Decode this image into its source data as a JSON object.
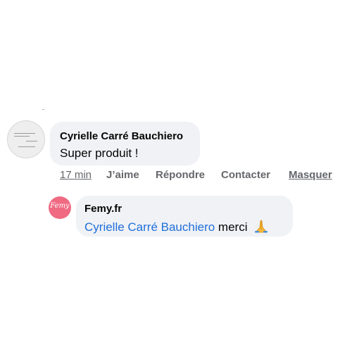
{
  "comment": {
    "author": "Cyrielle Carré Bauchiero",
    "text": "Super produit !",
    "avatar_icon": "quote-image-avatar",
    "actions": {
      "time": "17 min",
      "like": "J’aime",
      "reply": "Répondre",
      "contact": "Contacter",
      "hide": "Masquer"
    }
  },
  "reply": {
    "author": "Femy.fr",
    "avatar_icon": "femy-logo-avatar",
    "logo_text": "Femy",
    "mention": "Cyrielle Carré Bauchiero",
    "text": "merci",
    "emoji_icon": "folded-hands-icon"
  },
  "colors": {
    "bubble": "#f0f2f5",
    "mention": "#216fdb",
    "secondary_text": "#65676b",
    "femy_brand": "#f06a82"
  }
}
